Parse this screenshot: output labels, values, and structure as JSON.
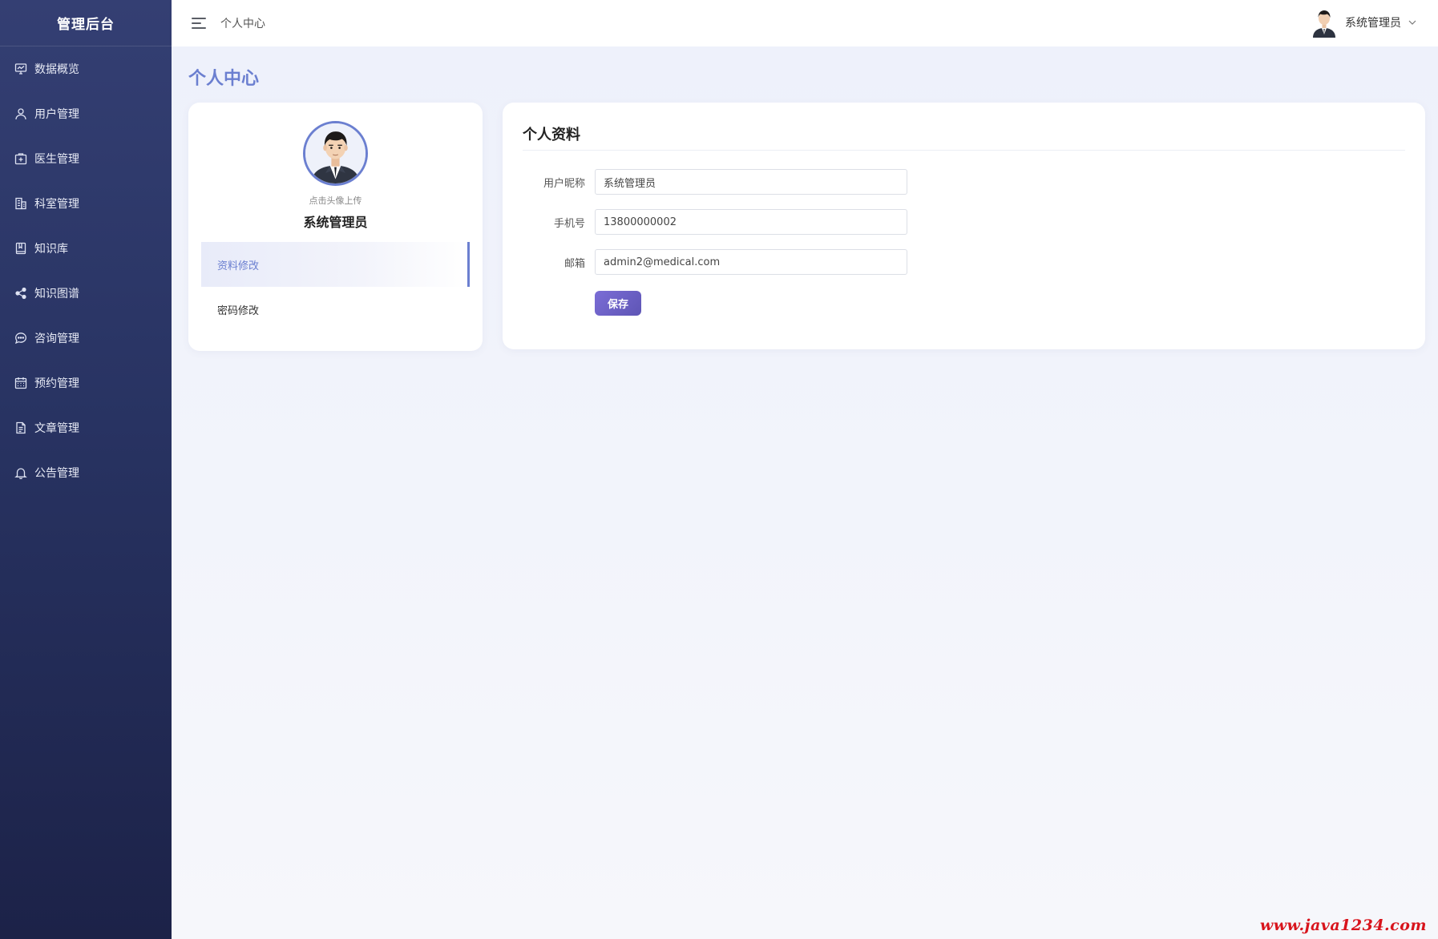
{
  "sidebar": {
    "brand": "管理后台",
    "items": [
      {
        "label": "数据概览",
        "icon": "chart-icon"
      },
      {
        "label": "用户管理",
        "icon": "user-icon"
      },
      {
        "label": "医生管理",
        "icon": "medical-case-icon"
      },
      {
        "label": "科室管理",
        "icon": "building-icon"
      },
      {
        "label": "知识库",
        "icon": "book-icon"
      },
      {
        "label": "知识图谱",
        "icon": "share-icon"
      },
      {
        "label": "咨询管理",
        "icon": "chat-icon"
      },
      {
        "label": "预约管理",
        "icon": "calendar-icon"
      },
      {
        "label": "文章管理",
        "icon": "document-icon"
      },
      {
        "label": "公告管理",
        "icon": "bell-icon"
      }
    ]
  },
  "header": {
    "breadcrumb": "个人中心",
    "user_name": "系统管理员"
  },
  "page": {
    "title": "个人中心"
  },
  "profile": {
    "upload_tip": "点击头像上传",
    "name": "系统管理员",
    "nav": [
      {
        "label": "资料修改",
        "active": true
      },
      {
        "label": "密码修改",
        "active": false
      }
    ]
  },
  "form": {
    "title": "个人资料",
    "nickname_label": "用户昵称",
    "nickname_value": "系统管理员",
    "phone_label": "手机号",
    "phone_value": "13800000002",
    "email_label": "邮箱",
    "email_value": "admin2@medical.com",
    "save_label": "保存"
  },
  "watermark": "www.java1234.com",
  "colors": {
    "accent": "#6b7fd0",
    "sidebar_top": "#343f73",
    "sidebar_bottom": "#1c2248",
    "button": "#6a5fc6",
    "watermark": "#d8141c"
  }
}
